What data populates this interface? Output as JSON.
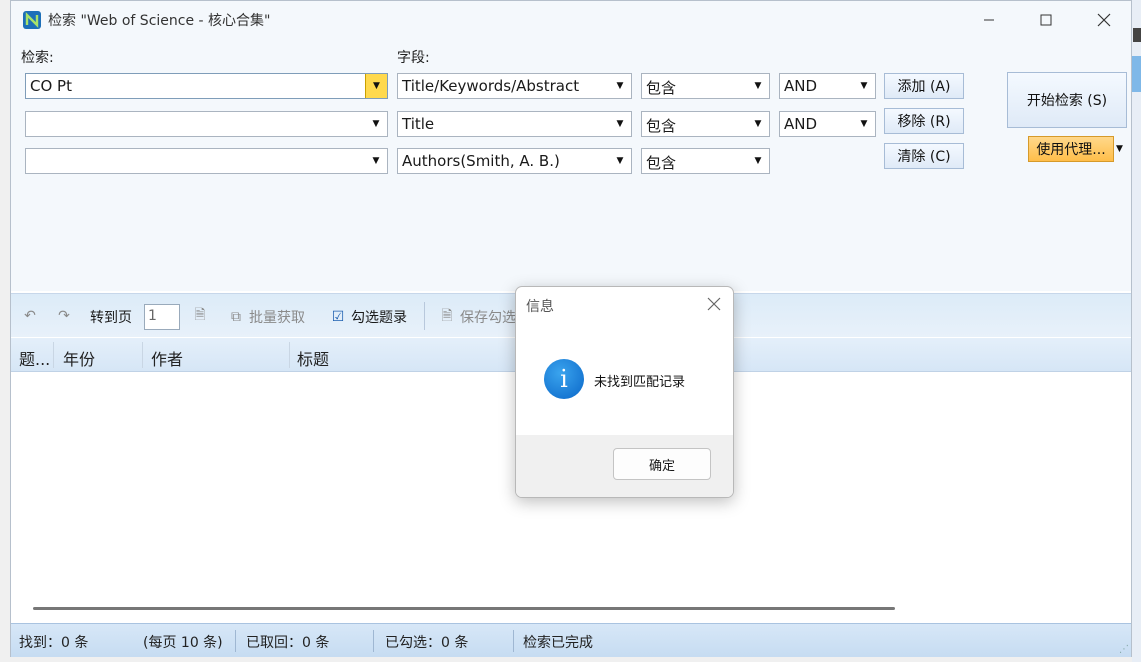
{
  "window": {
    "title": "检索 \"Web of Science - 核心合集\""
  },
  "search": {
    "search_label": "检索:",
    "field_label": "字段:",
    "rows": [
      {
        "query": "CO Pt",
        "field": "Title/Keywords/Abstract",
        "match": "包含",
        "operator": "AND"
      },
      {
        "query": "",
        "field": "Title",
        "match": "包含",
        "operator": "AND"
      },
      {
        "query": "",
        "field": "Authors(Smith, A. B.)",
        "match": "包含"
      }
    ],
    "add_label": "添加 (A)",
    "remove_label": "移除 (R)",
    "clear_label": "清除 (C)",
    "start_label": "开始检索 (S)",
    "proxy_label": "使用代理..."
  },
  "toolbar": {
    "goto_page_label": "转到页",
    "page_value": "1",
    "batch_fetch_label": "批量获取",
    "check_select_label": "勾选题录",
    "save_checked_label": "保存勾选"
  },
  "table": {
    "columns": [
      "题...",
      "年份",
      "作者",
      "标题"
    ]
  },
  "status": {
    "found": "找到：0 条",
    "per_page": "(每页 10 条)",
    "fetched": "已取回：0 条",
    "checked": "已勾选：0 条",
    "state": "检索已完成"
  },
  "dialog": {
    "title": "信息",
    "message": "未找到匹配记录",
    "ok_label": "确定"
  },
  "colors": {
    "accent": "#0a66c8",
    "proxy_button": "#ffbe4a",
    "active_dropdown": "#ffd94d"
  }
}
